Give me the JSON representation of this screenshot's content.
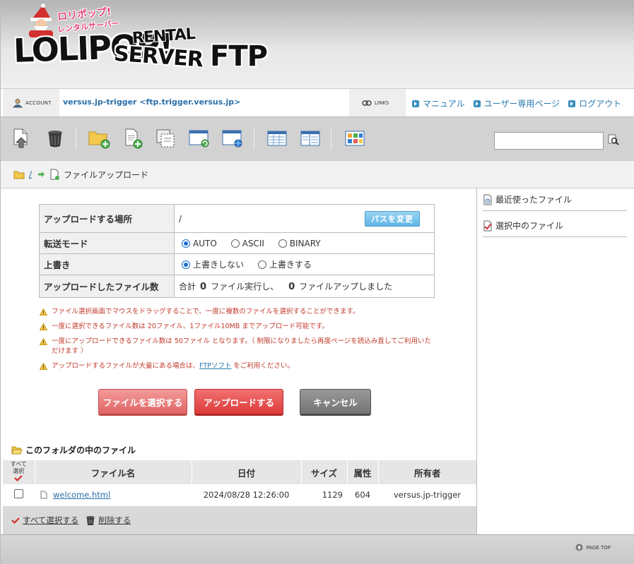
{
  "header": {
    "logo_badge_line1": "ロリポップ!",
    "logo_badge_line2": "レンタルサーバー",
    "logo_main": "LOLIPOP!",
    "logo_rental": "RENTAL",
    "logo_server": "SERVER",
    "logo_ftp": "FTP"
  },
  "account": {
    "label": "ACCOUNT",
    "value": "versus.jp-trigger <ftp.trigger.versus.jp>",
    "links_label": "LINKS",
    "links": [
      "マニュアル",
      "ユーザー専用ページ",
      "ログアウト"
    ]
  },
  "toolbar": {
    "icons": [
      "upload-file-icon",
      "trash-icon",
      "new-folder-icon",
      "new-file-icon",
      "copy-icon",
      "window-refresh-icon",
      "window-web-icon",
      "list-view-icon",
      "split-view-icon",
      "thumbnail-view-icon"
    ],
    "search_placeholder": ""
  },
  "breadcrumb": {
    "root": "/",
    "current": "ファイルアップロード"
  },
  "sidebar": {
    "items": [
      "最近使ったファイル",
      "選択中のファイル"
    ]
  },
  "form": {
    "location_label": "アップロードする場所",
    "location_value": "/",
    "change_path_button": "パスを変更",
    "mode_label": "転送モード",
    "mode_options": [
      "AUTO",
      "ASCII",
      "BINARY"
    ],
    "mode_selected": "AUTO",
    "overwrite_label": "上書き",
    "overwrite_options": [
      "上書きしない",
      "上書きする"
    ],
    "overwrite_selected": "上書きしない",
    "uploaded_label": "アップロードしたファイル数",
    "uploaded_prefix": "合計",
    "executed_count": "0",
    "executed_text": "ファイル実行し、",
    "uploaded_count": "0",
    "uploaded_text": "ファイルアップしました"
  },
  "notes": [
    "ファイル選択画面でマウスをドラッグすることで、一度に複数のファイルを選択することができます。",
    "一度に選択できるファイル数は 20ファイル、1ファイル10MB までアップロード可能です。",
    "一度にアップロードできるファイル数は 50ファイル となります。（ 制限になりましたら再度ページを読込み直してご利用いただけます ）"
  ],
  "note_ftp": {
    "before": "アップロードするファイルが大量にある場合は、",
    "link": "FTPソフト",
    "after": " をご利用ください。"
  },
  "buttons": {
    "select_files": "ファイルを選択する",
    "upload": "アップロードする",
    "cancel": "キャンセル"
  },
  "files": {
    "section_title": "このフォルダの中のファイル",
    "select_all_header": "すべて選択",
    "columns": [
      "ファイル名",
      "日付",
      "サイズ",
      "属性",
      "所有者"
    ],
    "rows": [
      {
        "name": "welcome.html",
        "date": "2024/08/28 12:26:00",
        "size": "1129",
        "perm": "604",
        "owner": "versus.jp-trigger"
      }
    ],
    "select_all_action": "すべて選択する",
    "delete_action": "削除する"
  },
  "footer": {
    "pagetop": "PAGE TOP"
  },
  "colors": {
    "link_blue": "#2a6fa8",
    "note_red": "#c0392b",
    "btn_red": "#dd3b3b",
    "btn_pink": "#e06565",
    "btn_gray": "#737373"
  }
}
